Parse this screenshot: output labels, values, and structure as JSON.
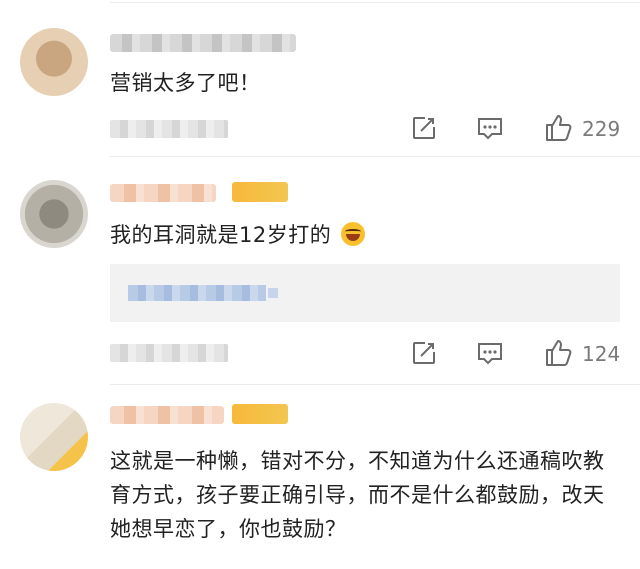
{
  "comments": [
    {
      "text": "营销太多了吧！",
      "likes": "229",
      "icons": [
        "share-icon",
        "comment-icon",
        "thumbs-up-icon"
      ]
    },
    {
      "text": "我的耳洞就是12岁打的",
      "emoji": "laughing-with-tears-emoji",
      "likes": "124",
      "icons": [
        "share-icon",
        "comment-icon",
        "thumbs-up-icon"
      ]
    },
    {
      "text": "这就是一种懒，错对不分，不知道为什么还通稿吹教育方式，孩子要正确引导，而不是什么都鼓励，改天她想早恋了，你也鼓励？",
      "icons": []
    }
  ],
  "colors": {
    "badge": "#f6b93b",
    "reply_bg": "#f2f2f2",
    "icon": "#6b6b6b",
    "divider": "#ececec"
  }
}
